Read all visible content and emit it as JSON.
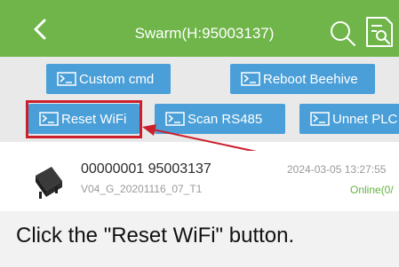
{
  "header": {
    "title": "Swarm(H:95003137)",
    "back_icon": "chevron-left-icon",
    "search_icon": "search-icon",
    "doc_icon": "document-search-icon",
    "color": "#6fb54a"
  },
  "commands": {
    "custom_cmd": "Custom cmd",
    "reboot_beehive": "Reboot Beehive",
    "reset_wifi": "Reset WiFi",
    "scan_rs485": "Scan RS485",
    "unnet_plc": "Unnet PLC",
    "icon": "terminal-icon",
    "button_color": "#4a9fd8",
    "highlight_color": "#cc1f2c"
  },
  "device": {
    "id": "00000001 95003137",
    "version": "V04_G_20201116_07_T1",
    "timestamp": "2024-03-05 13:27:55",
    "status": "Online(0/",
    "status_color": "#62b23f"
  },
  "instruction": {
    "text": "Click the \"Reset WiFi\" button."
  }
}
